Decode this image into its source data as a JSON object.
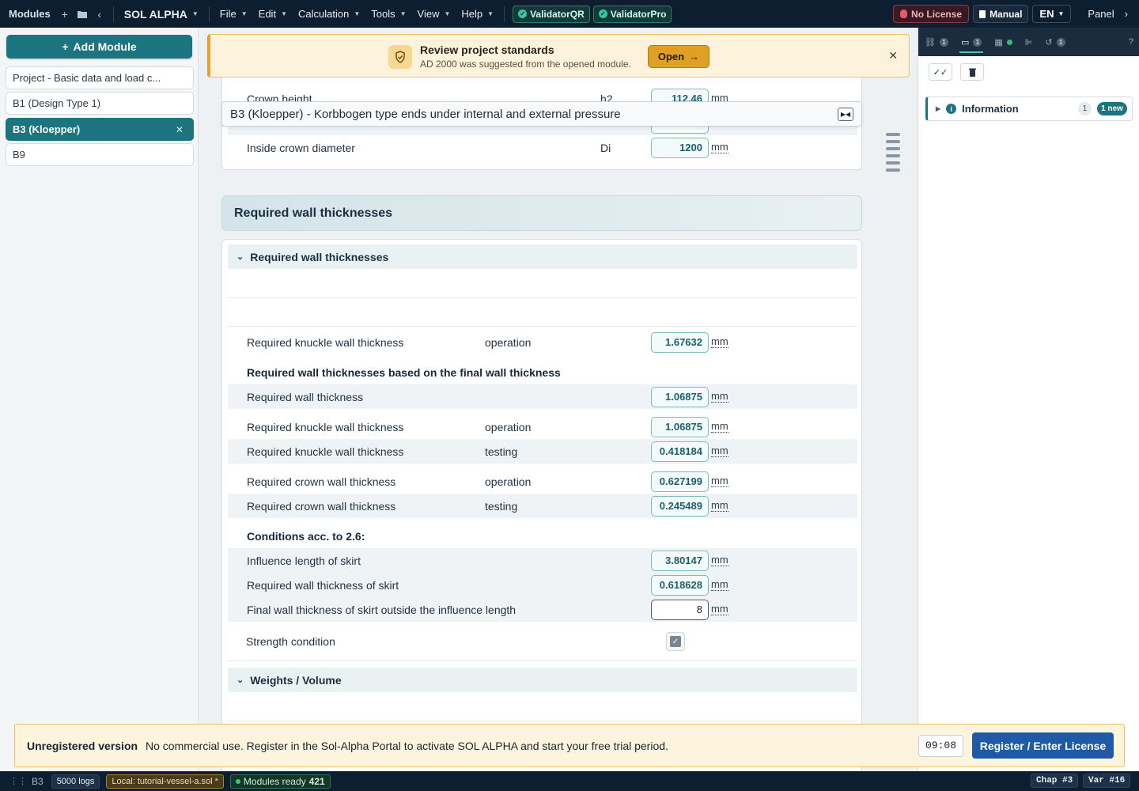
{
  "topbar": {
    "modules": "Modules",
    "app_name": "SOL ALPHA",
    "menus": [
      "File",
      "Edit",
      "Calculation",
      "Tools",
      "View",
      "Help"
    ],
    "validators": [
      "ValidatorQR",
      "ValidatorPro"
    ],
    "no_license": "No License",
    "manual": "Manual",
    "language": "EN",
    "panel": "Panel"
  },
  "sidebar": {
    "add_module": "Add Module",
    "modules": [
      "Project - Basic data and load c...",
      "B1 (Design Type 1)",
      "B3 (Kloepper)",
      "B9"
    ]
  },
  "review_banner": {
    "title": "Review project standards",
    "message": "AD 2000 was suggested from the opened module.",
    "open_label": "Open"
  },
  "module_title": "B3 (Kloepper) - Korbbogen type ends under internal and external pressure",
  "top_rows": [
    {
      "label": "Crown height",
      "symbol": "h2",
      "value": "112.46",
      "unit": "mm"
    },
    {
      "label": "Inside crown diameter",
      "symbol": "Di",
      "value": "1200",
      "unit": "mm"
    }
  ],
  "section_title": "Required wall thicknesses",
  "subsection_title": "Required wall thicknesses",
  "rows_a": [
    {
      "label": "Required knuckle wall thickness",
      "condition": "operation",
      "value": "1.67632",
      "unit": "mm"
    }
  ],
  "subhead_final": "Required wall thicknesses based on the final wall thickness",
  "rows_b": [
    {
      "label": "Required wall thickness",
      "condition": "",
      "value": "1.06875",
      "unit": "mm"
    },
    {
      "label": "Required knuckle wall thickness",
      "condition": "operation",
      "value": "1.06875",
      "unit": "mm"
    },
    {
      "label": "Required knuckle wall thickness",
      "condition": "testing",
      "value": "0.418184",
      "unit": "mm"
    },
    {
      "label": "Required crown wall thickness",
      "condition": "operation",
      "value": "0.627199",
      "unit": "mm"
    },
    {
      "label": "Required crown wall thickness",
      "condition": "testing",
      "value": "0.245489",
      "unit": "mm"
    }
  ],
  "subhead_conditions": "Conditions acc. to 2.6:",
  "rows_c": [
    {
      "label": "Influence length of skirt",
      "value": "3.80147",
      "unit": "mm"
    },
    {
      "label": "Required wall thickness of skirt",
      "value": "0.618628",
      "unit": "mm"
    },
    {
      "label": "Final wall thickness of skirt outside the influence length",
      "value": "8",
      "unit": "mm"
    }
  ],
  "strength_condition": "Strength condition",
  "strength_checked": true,
  "weights_section": "Weights / Volume",
  "right_panel": {
    "tab_counts": [
      "1",
      "1",
      "1"
    ],
    "information": "Information",
    "info_count": "1",
    "info_new": "1 new"
  },
  "unregistered": {
    "title": "Unregistered version",
    "message": "No commercial use. Register in the Sol-Alpha Portal to activate SOL ALPHA and start your free trial period.",
    "timer": "09:08",
    "register_label": "Register / Enter License"
  },
  "statusbar": {
    "module": "B3",
    "logs": "5000 logs",
    "local": "Local: tutorial-vessel-a.sol *",
    "ready": "Modules ready",
    "ready_count": "421",
    "chap": "Chap #3",
    "var": "Var #16"
  }
}
